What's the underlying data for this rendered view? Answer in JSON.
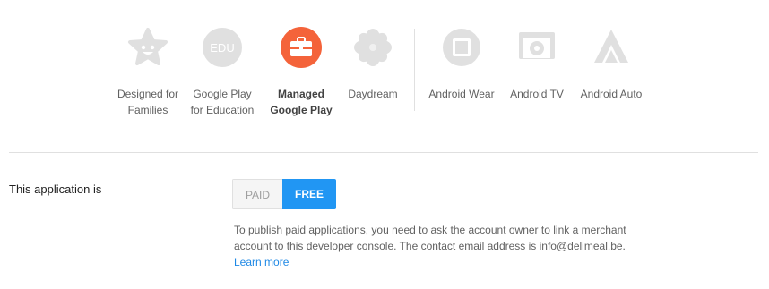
{
  "programs": [
    {
      "id": "families",
      "label_line1": "Designed for",
      "label_line2": "Families",
      "icon": "star-face-icon",
      "active": false
    },
    {
      "id": "education",
      "label_line1": "Google Play",
      "label_line2": "for Education",
      "icon": "edu-icon",
      "icon_text": "EDU",
      "active": false
    },
    {
      "id": "managed",
      "label_line1": "Managed",
      "label_line2": "Google Play",
      "icon": "briefcase-icon",
      "active": true
    },
    {
      "id": "daydream",
      "label_line1": "Daydream",
      "label_line2": "",
      "icon": "daydream-icon",
      "active": false
    },
    {
      "id": "wear",
      "label_line1": "Android Wear",
      "label_line2": "",
      "icon": "watch-icon",
      "active": false
    },
    {
      "id": "tv",
      "label_line1": "Android TV",
      "label_line2": "",
      "icon": "tv-icon",
      "active": false
    },
    {
      "id": "auto",
      "label_line1": "Android Auto",
      "label_line2": "",
      "icon": "auto-icon",
      "active": false
    }
  ],
  "pricing": {
    "label": "This application is",
    "paid_label": "PAID",
    "free_label": "FREE",
    "selected": "FREE",
    "info_text": "To publish paid applications, you need to ask the account owner to link a merchant account to this developer console. The contact email address is info@delimeal.be.",
    "learn_more": "Learn more"
  },
  "colors": {
    "accent": "#2196f3",
    "managed_icon": "#f4633a",
    "icon_gray": "#e0e0e0",
    "link": "#1e88e5"
  }
}
